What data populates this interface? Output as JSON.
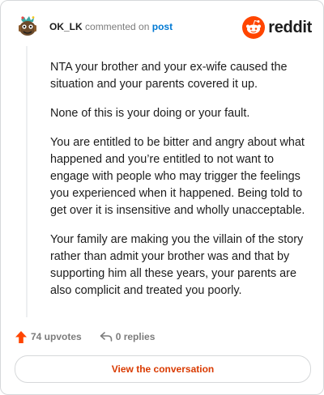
{
  "comment": {
    "author": "OK_LK",
    "action_text": "commented on",
    "post_link_text": "post",
    "paragraphs": [
      "NTA your brother and your ex-wife caused the situation and your parents covered it up.",
      "None of this is your doing or your fault.",
      "You are entitled to be bitter and angry about what happened and you’re entitled to not want to engage with people who may trigger the feelings you experienced when it happened. Being told to get over it is insensitive and wholly unacceptable.",
      "Your family are making you the villain of the story rather than admit your brother was and that by supporting him all these years, your parents are also complicit and treated you poorly."
    ]
  },
  "brand": {
    "name": "reddit",
    "color": "#ff4500"
  },
  "footer": {
    "upvotes": "74 upvotes",
    "replies": "0 replies",
    "upvote_color": "#ff4500"
  },
  "cta": {
    "label": "View the conversation"
  }
}
